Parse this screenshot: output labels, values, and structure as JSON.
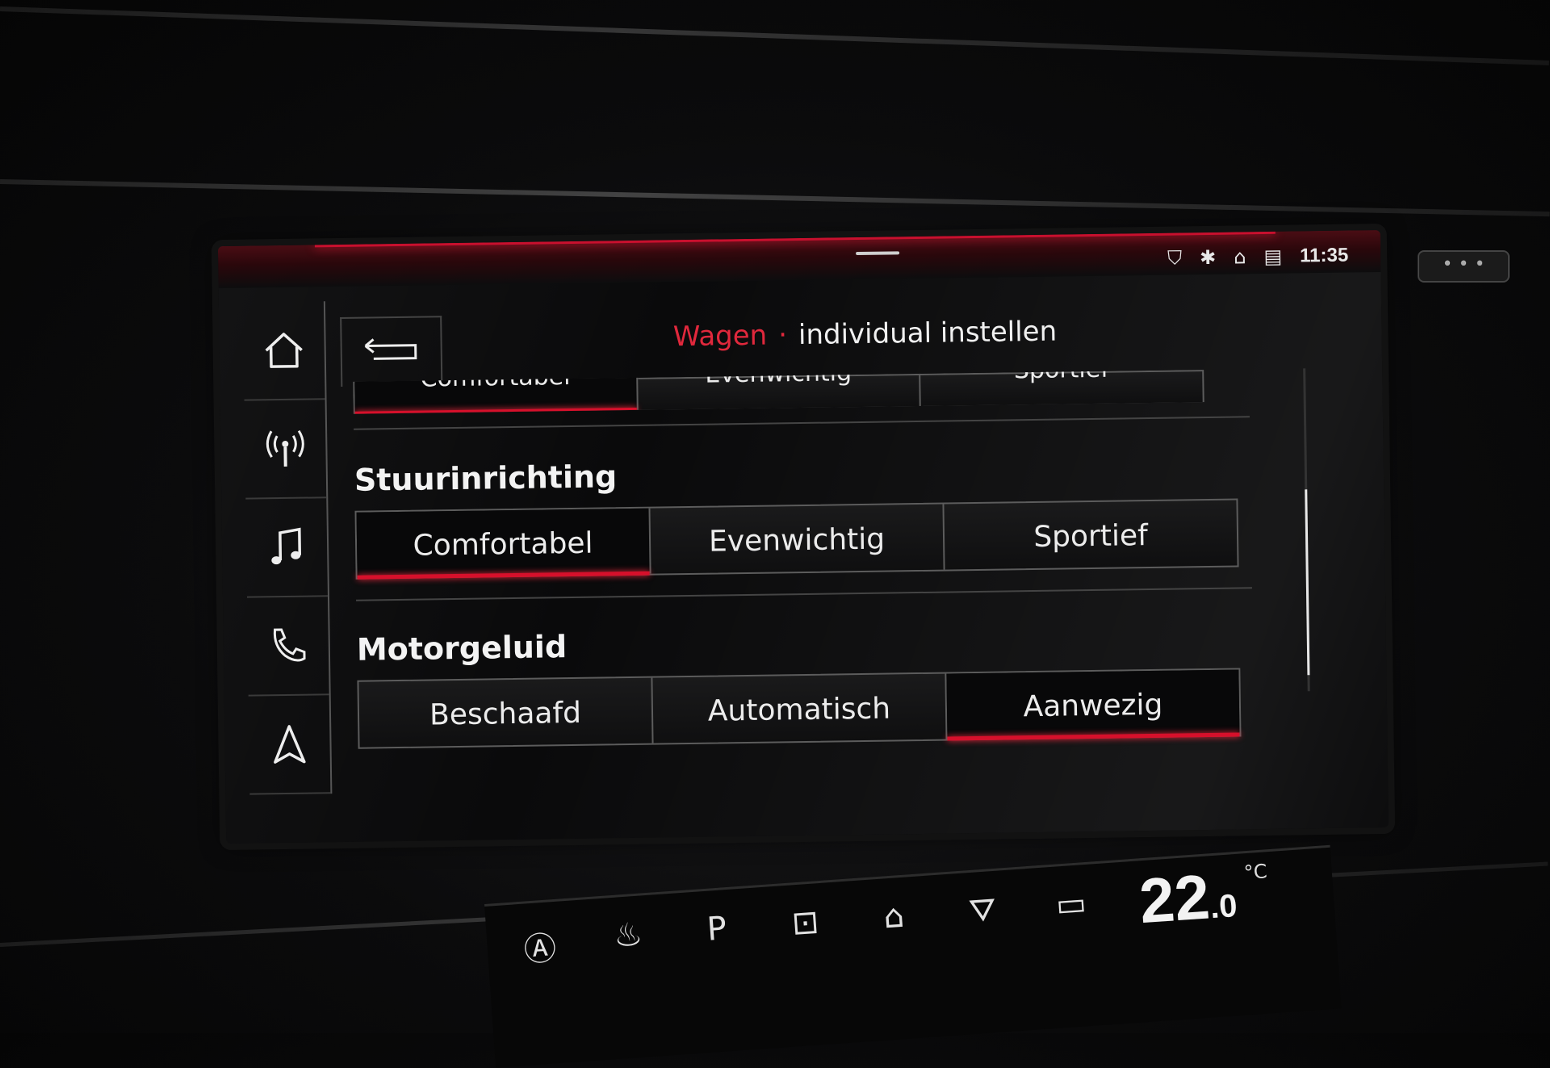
{
  "status": {
    "time": "11:35",
    "icons": [
      "location-shield-icon",
      "bluetooth-icon",
      "user-profile-icon",
      "lte-signal-icon"
    ],
    "icon_glyphs": [
      "⛉",
      "✱",
      "⌂",
      "▤"
    ]
  },
  "nav": {
    "items": [
      "home-icon",
      "radio-icon",
      "music-icon",
      "phone-icon",
      "navigation-icon"
    ]
  },
  "header": {
    "crumb": "Wagen",
    "separator": "·",
    "title": "individual instellen"
  },
  "sections": [
    {
      "title": "",
      "options": [
        "Comfortabel",
        "Evenwichtig",
        "Sportief"
      ],
      "selected": 0
    },
    {
      "title": "Stuurinrichting",
      "options": [
        "Comfortabel",
        "Evenwichtig",
        "Sportief"
      ],
      "selected": 0
    },
    {
      "title": "Motorgeluid",
      "options": [
        "Beschaafd",
        "Automatisch",
        "Aanwezig"
      ],
      "selected": 2
    }
  ],
  "colors": {
    "accent": "#d6102b",
    "background": "#0a0a0b"
  },
  "climate": {
    "icons": [
      "auto-climate-icon",
      "seat-heat-icon",
      "parking-icon",
      "park-assist-icon",
      "home-climate-icon",
      "rear-defrost-off-icon",
      "defrost-icon"
    ],
    "temperature": "22",
    "temperature_decimal": ".0",
    "unit": "°C"
  }
}
